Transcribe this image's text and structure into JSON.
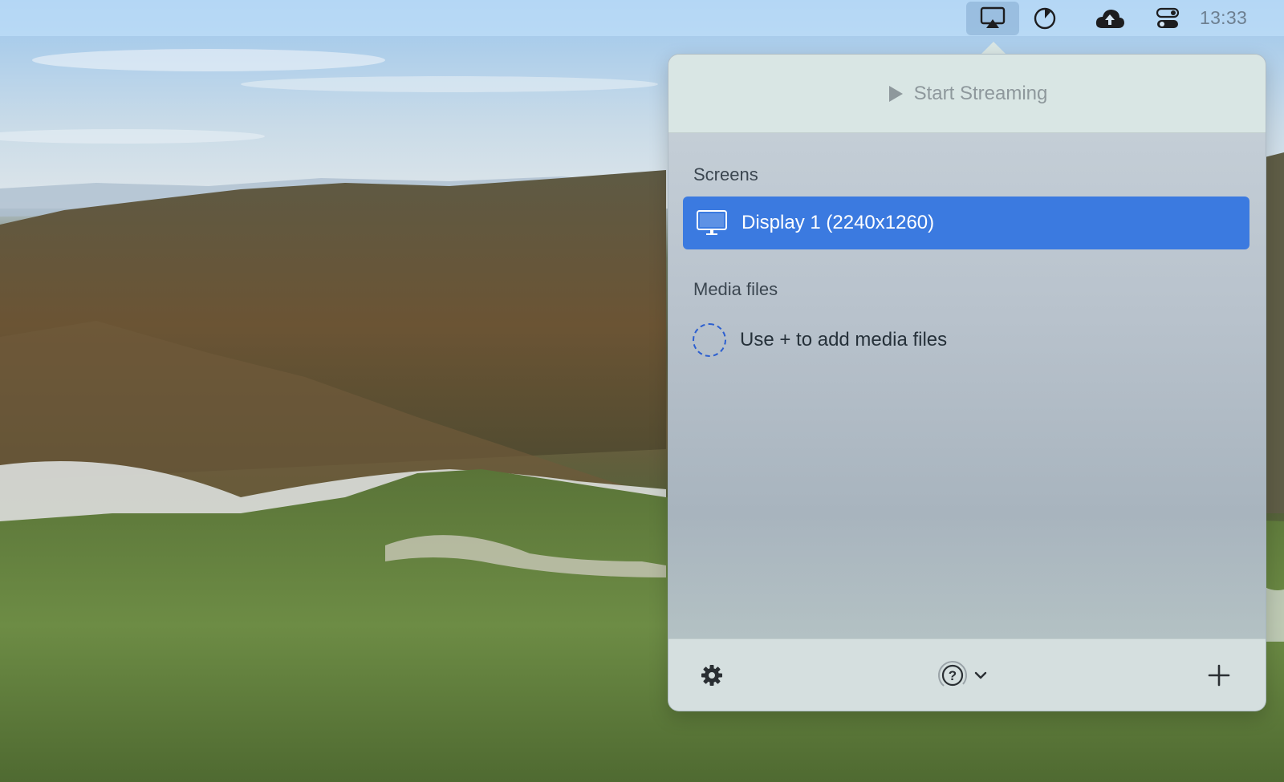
{
  "menubar": {
    "items": [
      {
        "icon": "airplay-icon",
        "active": true
      },
      {
        "icon": "timer-icon"
      },
      {
        "icon": "cloud-upload-icon"
      },
      {
        "icon": "control-center-icon"
      }
    ],
    "clock": "13:33"
  },
  "popover": {
    "start_streaming_label": "Start Streaming",
    "screens": {
      "heading": "Screens",
      "items": [
        {
          "label": "Display 1 (2240x1260)",
          "icon": "monitor-icon",
          "selected": true
        }
      ]
    },
    "media_files": {
      "heading": "Media files",
      "empty_hint": "Use + to add media files"
    },
    "footer": {
      "settings_icon": "gear-icon",
      "receiver_icon": "airplay-question-icon",
      "dropdown_icon": "chevron-down-icon",
      "add_icon": "plus-icon"
    }
  },
  "colors": {
    "accent": "#3b7ae0",
    "menubar": "#bedef8",
    "popover_header": "#d9e6e4"
  }
}
